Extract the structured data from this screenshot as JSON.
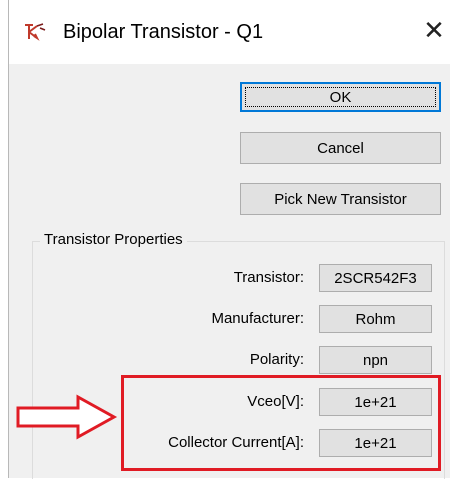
{
  "window": {
    "title": "Bipolar Transistor - Q1",
    "close_symbol": "✕"
  },
  "buttons": {
    "ok": "OK",
    "cancel": "Cancel",
    "pick_new": "Pick New Transistor"
  },
  "properties": {
    "group_title": "Transistor Properties",
    "rows": [
      {
        "label": "Transistor:",
        "value": "2SCR542F3"
      },
      {
        "label": "Manufacturer:",
        "value": "Rohm"
      },
      {
        "label": "Polarity:",
        "value": "npn"
      },
      {
        "label": "Vceo[V]:",
        "value": "1e+21"
      },
      {
        "label": "Collector Current[A]:",
        "value": "1e+21"
      }
    ]
  },
  "annotation": {
    "highlight_color": "#e01b24",
    "arrow_icon": "right-arrow-icon"
  },
  "colors": {
    "window_bg": "#f0f0f0",
    "button_bg": "#e1e1e1",
    "focus_border": "#0078d7"
  }
}
